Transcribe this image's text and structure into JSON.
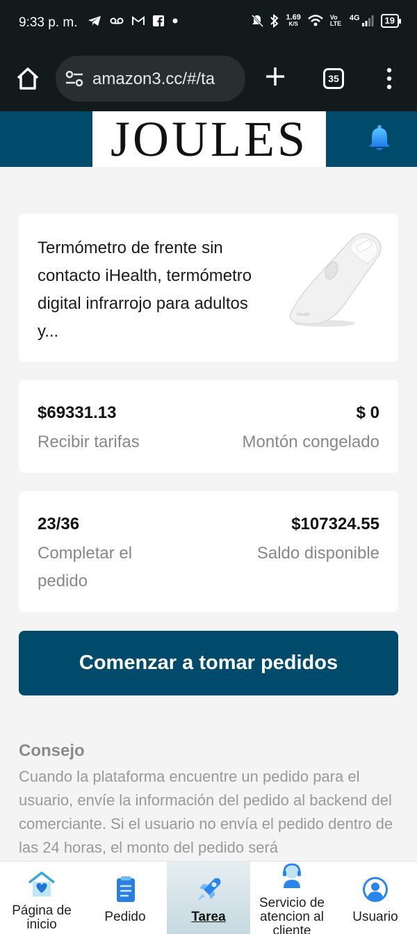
{
  "status_bar": {
    "time": "9:33 p. m.",
    "left_icons": [
      "telegram-icon",
      "voicemail-icon",
      "gmail-icon",
      "facebook-icon",
      "dot-icon"
    ],
    "net_speed": "1.69",
    "net_speed_unit": "K/S",
    "volte": "Vo LTE",
    "network": "4G",
    "battery": "19"
  },
  "browser": {
    "url": "amazon3.cc/#/ta",
    "tab_count": "35"
  },
  "header": {
    "brand": "JOULES",
    "accent_color": "#004b6c"
  },
  "product": {
    "title": "Termómetro de frente sin contacto iHealth, termómetro digital infrarrojo para adultos y..."
  },
  "stats": {
    "fees_value": "$69331.13",
    "fees_label": "Recibir tarifas",
    "frozen_value": "$ 0",
    "frozen_label": "Montón congelado",
    "progress_value": "23/36",
    "progress_label": "Completar el pedido",
    "balance_value": "$107324.55",
    "balance_label": "Saldo disponible"
  },
  "cta": {
    "label": "Comenzar a tomar pedidos"
  },
  "tip": {
    "title": "Consejo",
    "text": "Cuando la plataforma encuentre un pedido para el usuario, envíe la información del pedido al backend del comerciante. Si el usuario no envía el pedido dentro de las 24 horas, el monto del pedido será"
  },
  "nav": {
    "items": [
      {
        "label": "Página de inicio",
        "icon": "home-heart-icon"
      },
      {
        "label": "Pedido",
        "icon": "clipboard-icon"
      },
      {
        "label": "Tarea",
        "icon": "rocket-icon",
        "active": true
      },
      {
        "label": "Servicio de atencion al cliente",
        "icon": "support-agent-icon"
      },
      {
        "label": "Usuario",
        "icon": "user-icon"
      }
    ]
  }
}
